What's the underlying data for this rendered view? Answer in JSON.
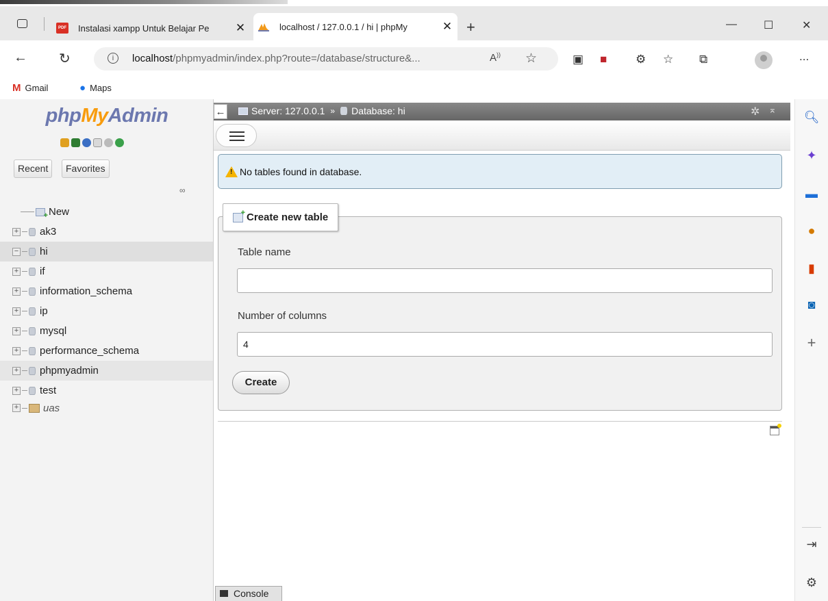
{
  "browser": {
    "tabs": [
      {
        "title": "Instalasi xampp Untuk Belajar Pe",
        "favicon": "pdf-icon",
        "close": "✕"
      },
      {
        "title": "localhost / 127.0.0.1 / hi | phpMy",
        "favicon": "pma-icon",
        "close": "✕"
      }
    ],
    "new_tab": "+",
    "window_controls": {
      "minimize": "—",
      "maximize": "☐",
      "close": "✕"
    },
    "url_host": "localhost",
    "url_rest": "/phpmyadmin/index.php?route=/database/structure&...",
    "read_aloud": "A",
    "bookmarks": [
      {
        "label": "Gmail",
        "icon": "gmail-icon"
      },
      {
        "label": "Maps",
        "icon": "maps-icon"
      }
    ],
    "menu": "..."
  },
  "pma": {
    "logo": {
      "php": "php",
      "my": "My",
      "admin": "Admin"
    },
    "nav_buttons": {
      "recent": "Recent",
      "favorites": "Favorites"
    },
    "tree": [
      {
        "label": "New",
        "type": "new"
      },
      {
        "label": "ak3",
        "type": "db"
      },
      {
        "label": "hi",
        "type": "db",
        "selected": true
      },
      {
        "label": "if",
        "type": "db"
      },
      {
        "label": "information_schema",
        "type": "db"
      },
      {
        "label": "ip",
        "type": "db"
      },
      {
        "label": "mysql",
        "type": "db"
      },
      {
        "label": "performance_schema",
        "type": "db"
      },
      {
        "label": "phpmyadmin",
        "type": "db",
        "hover": true
      },
      {
        "label": "test",
        "type": "db"
      },
      {
        "label": "uas",
        "type": "db-italic"
      }
    ],
    "breadcrumb": {
      "server": "Server: 127.0.0.1",
      "separator": "»",
      "database": "Database: hi"
    },
    "notice": "No tables found in database.",
    "create_table": {
      "legend": "Create new table",
      "table_name_label": "Table name",
      "table_name_value": "",
      "columns_label": "Number of columns",
      "columns_value": "4",
      "button": "Create"
    },
    "console": "Console"
  }
}
